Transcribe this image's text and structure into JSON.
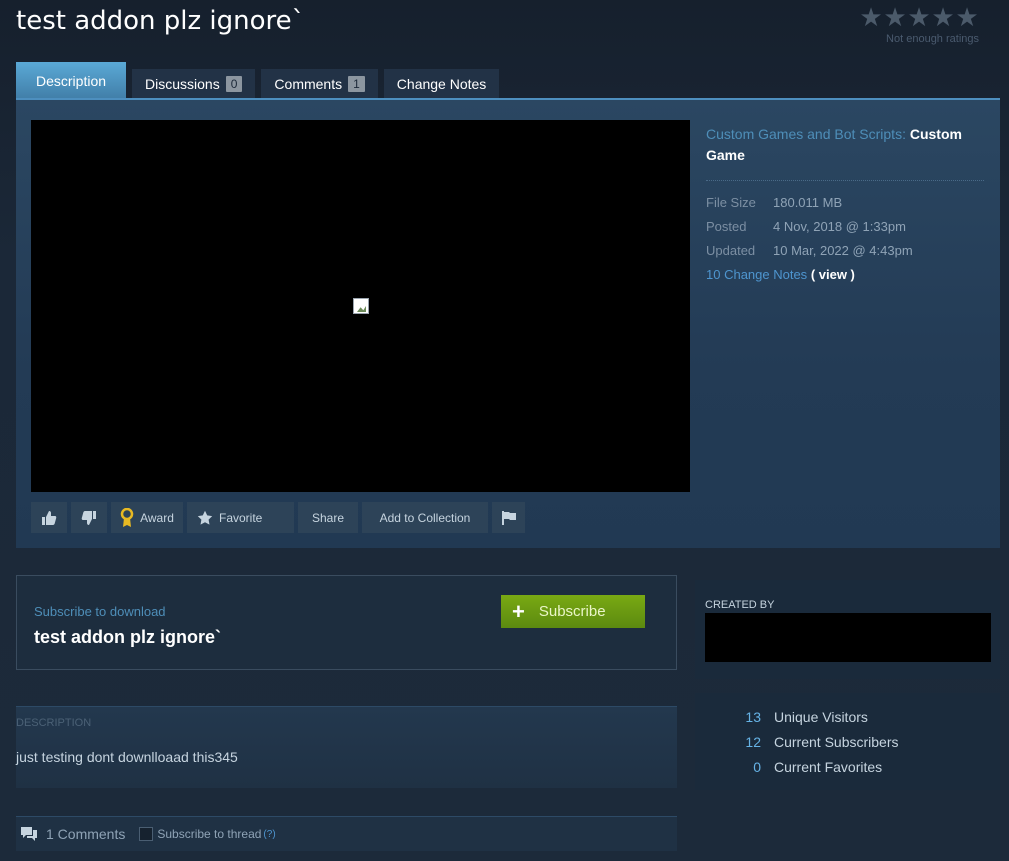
{
  "page": {
    "title": "test addon plz ignore`"
  },
  "rating": {
    "stars": [
      "★",
      "★",
      "★",
      "★",
      "★"
    ],
    "label": "Not enough ratings"
  },
  "tabs": [
    {
      "label": "Description",
      "count": null
    },
    {
      "label": "Discussions",
      "count": "0"
    },
    {
      "label": "Comments",
      "count": "1"
    },
    {
      "label": "Change Notes",
      "count": null
    }
  ],
  "actions": {
    "award": "Award",
    "favorite": "Favorite",
    "share": "Share",
    "add_to_collection": "Add to Collection"
  },
  "info": {
    "category_prefix": "Custom Games and Bot Scripts:",
    "category": "Custom Game",
    "file_size_label": "File Size",
    "file_size": "180.011 MB",
    "posted_label": "Posted",
    "posted": "4 Nov, 2018 @ 1:33pm",
    "updated_label": "Updated",
    "updated": "10 Mar, 2022 @ 4:43pm",
    "change_notes_link": "10 Change Notes",
    "view_link": "( view )"
  },
  "subscribe": {
    "label": "Subscribe to download",
    "title": "test addon plz ignore`",
    "button": "Subscribe",
    "plus": "+"
  },
  "description": {
    "label": "DESCRIPTION",
    "text": "just testing dont downlloaad this345"
  },
  "comments": {
    "count_text": "1 Comments",
    "subscribe_thread": "Subscribe to thread",
    "help": "(?)"
  },
  "created": {
    "label": "CREATED BY"
  },
  "stats": [
    {
      "value": "13",
      "label": "Unique Visitors"
    },
    {
      "value": "12",
      "label": "Current Subscribers"
    },
    {
      "value": "0",
      "label": "Current Favorites"
    }
  ],
  "colors": {
    "background": "#1b2838",
    "accent_blue": "#417ea8",
    "subscribe_green": "#79a913",
    "link": "#4e95cf"
  }
}
